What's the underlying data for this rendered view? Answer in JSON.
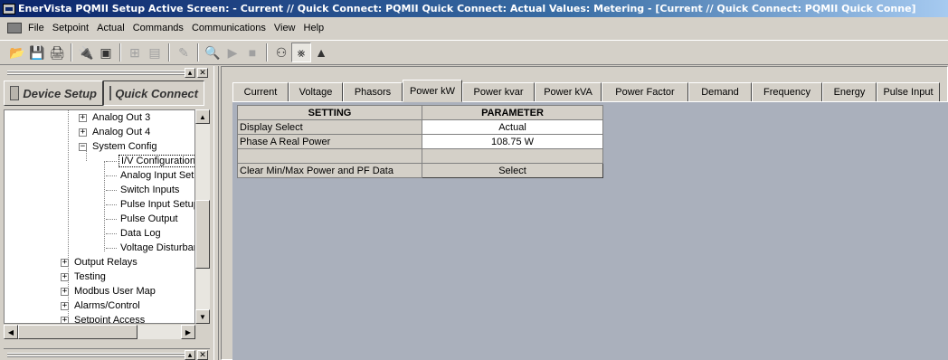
{
  "window": {
    "title": "EnerVista PQMII Setup Active Screen:  - Current // Quick Connect: PQMII Quick Connect: Actual Values: Metering - [Current // Quick Connect: PQMII Quick Conne]"
  },
  "menu": [
    "File",
    "Setpoint",
    "Actual",
    "Commands",
    "Communications",
    "View",
    "Help"
  ],
  "toolbar": {
    "buttons": [
      {
        "name": "open-icon",
        "glyph": "📂",
        "enabled": true
      },
      {
        "name": "save-icon",
        "glyph": "💾",
        "enabled": false
      },
      {
        "name": "print-icon",
        "glyph": "🖨",
        "enabled": true
      },
      {
        "name": "sep"
      },
      {
        "name": "connect-icon",
        "glyph": "🔌",
        "enabled": true
      },
      {
        "name": "device-icon",
        "glyph": "▣",
        "enabled": true
      },
      {
        "name": "sep"
      },
      {
        "name": "tree-icon",
        "glyph": "⊞",
        "enabled": false
      },
      {
        "name": "doc-icon",
        "glyph": "▤",
        "enabled": false
      },
      {
        "name": "sep"
      },
      {
        "name": "edit-icon",
        "glyph": "✎",
        "enabled": false
      },
      {
        "name": "sep"
      },
      {
        "name": "zoom-icon",
        "glyph": "🔍",
        "enabled": false
      },
      {
        "name": "play-icon",
        "glyph": "▶",
        "enabled": false
      },
      {
        "name": "stop-icon",
        "glyph": "■",
        "enabled": false
      },
      {
        "name": "sep"
      },
      {
        "name": "binoculars-icon",
        "glyph": "⚇",
        "enabled": true
      },
      {
        "name": "antenna-icon",
        "glyph": "⨳",
        "enabled": true,
        "pressed": true
      },
      {
        "name": "triangle-icon",
        "glyph": "▲",
        "enabled": true
      }
    ]
  },
  "left_panel": {
    "tabs": [
      "Device Setup",
      "Quick Connect"
    ],
    "tree": [
      {
        "label": "Analog Out 3",
        "level": 2,
        "expander": "+"
      },
      {
        "label": "Analog Out 4",
        "level": 2,
        "expander": "+"
      },
      {
        "label": "System Config",
        "level": 2,
        "expander": "−"
      },
      {
        "label": "I/V Configuration",
        "level": 3,
        "selected": true
      },
      {
        "label": "Analog Input Setup",
        "level": 3
      },
      {
        "label": "Switch Inputs",
        "level": 3
      },
      {
        "label": "Pulse Input Setup",
        "level": 3
      },
      {
        "label": "Pulse Output",
        "level": 3
      },
      {
        "label": "Data Log",
        "level": 3
      },
      {
        "label": "Voltage Disturbance",
        "level": 3
      },
      {
        "label": "Output Relays",
        "level": 1,
        "expander": "+"
      },
      {
        "label": "Testing",
        "level": 1,
        "expander": "+"
      },
      {
        "label": "Modbus User Map",
        "level": 1,
        "expander": "+"
      },
      {
        "label": "Alarms/Control",
        "level": 1,
        "expander": "+"
      },
      {
        "label": "Setpoint Access",
        "level": 1,
        "expander": "+"
      }
    ]
  },
  "content": {
    "tabs": [
      "Current",
      "Voltage",
      "Phasors",
      "Power kW",
      "Power kvar",
      "Power kVA",
      "Power Factor",
      "Demand",
      "Frequency",
      "Energy",
      "Pulse Input"
    ],
    "active_tab": "Power kW",
    "grid": {
      "headers": [
        "SETTING",
        "PARAMETER"
      ],
      "rows": [
        {
          "setting": "Display Select",
          "value": "Actual"
        },
        {
          "setting": "Phase A Real Power",
          "value": "108.75  W"
        }
      ],
      "command": {
        "setting": "Clear Min/Max Power and PF Data",
        "button": "Select"
      }
    }
  }
}
